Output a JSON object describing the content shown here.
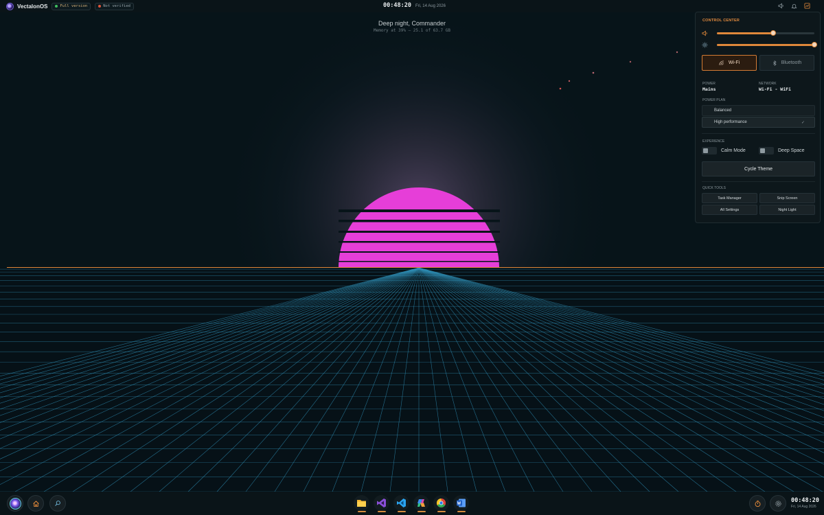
{
  "topbar": {
    "brand": "VectalonOS",
    "badges": [
      {
        "label": "Full version",
        "dot_color": "#3fbf5f"
      },
      {
        "label": "Not verified",
        "dot_color": "#e0553a"
      }
    ],
    "time": "00:48:20",
    "date": "Fri, 14 Aug 2026",
    "tray_icons": [
      "volume-icon",
      "bell-icon",
      "control-center-icon"
    ]
  },
  "greeting": {
    "title": "Deep night, Commander",
    "subtitle": "Memory at 39% — 25.1 of 63.7 GB"
  },
  "wallpaper": {
    "sun_color": "#e63ed8",
    "horizon_color": "#e0883a",
    "grid_color": "#2f8fb5"
  },
  "control_center": {
    "title": "CONTROL CENTER",
    "volume": {
      "icon": "volume-icon",
      "level": 0.58
    },
    "brightness": {
      "icon": "sun-icon",
      "level": 1.0
    },
    "wifi_label": "Wi-Fi",
    "bluetooth_label": "Bluetooth",
    "power_label": "POWER",
    "power_value": "Mains",
    "network_label": "NETWORK",
    "network_value": "Wi-Fi - WiFi",
    "power_plan_label": "POWER PLAN",
    "plans": [
      {
        "label": "Balanced",
        "selected": false
      },
      {
        "label": "High performance",
        "selected": true
      }
    ],
    "experience_label": "EXPERIENCE",
    "calm_mode": "Calm Mode",
    "deep_space": "Deep Space",
    "cycle_theme": "Cycle Theme",
    "quick_tools_label": "QUICK TOOLS",
    "tools": [
      "Task Manager",
      "Snip Screen",
      "All Settings",
      "Night Light"
    ]
  },
  "taskbar": {
    "apps": [
      "file-explorer-icon",
      "visual-studio-icon",
      "vscode-icon",
      "copilot-icon",
      "chrome-icon",
      "word-icon"
    ],
    "time": "00:48:20",
    "date": "Fri, 14 Aug 2026"
  }
}
